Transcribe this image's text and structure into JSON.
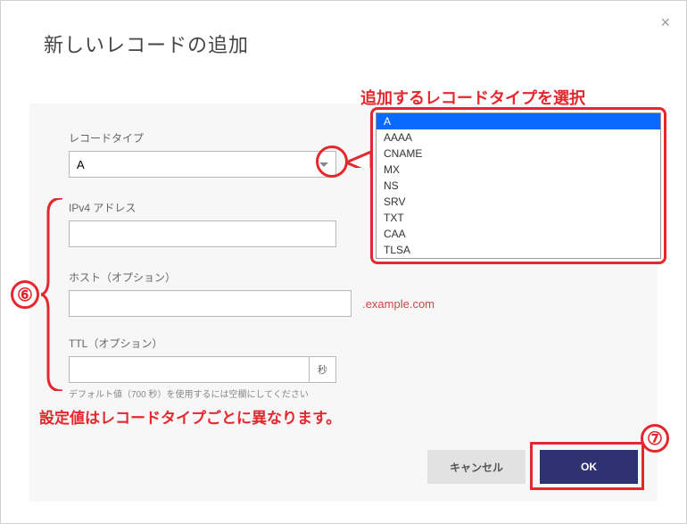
{
  "dialog": {
    "title": "新しいレコードの追加"
  },
  "fields": {
    "record_type": {
      "label": "レコードタイプ",
      "value": "A"
    },
    "ipv4": {
      "label": "IPv4 アドレス",
      "value": ""
    },
    "host": {
      "label": "ホスト（オプション）",
      "value": "",
      "suffix": ".example.com"
    },
    "ttl": {
      "label": "TTL（オプション）",
      "value": "",
      "unit": "秒",
      "hint": "デフォルト値（700 秒）を使用するには空欄にしてください"
    }
  },
  "dropdown": {
    "options": [
      "A",
      "AAAA",
      "CNAME",
      "MX",
      "NS",
      "SRV",
      "TXT",
      "CAA",
      "TLSA"
    ],
    "selected": "A"
  },
  "buttons": {
    "cancel": "キャンセル",
    "ok": "OK"
  },
  "annotations": {
    "select_type": "追加するレコードタイプを選択",
    "values_vary": "設定値はレコードタイプごとに異なります。",
    "badge6": "⑥",
    "badge7": "⑦"
  }
}
